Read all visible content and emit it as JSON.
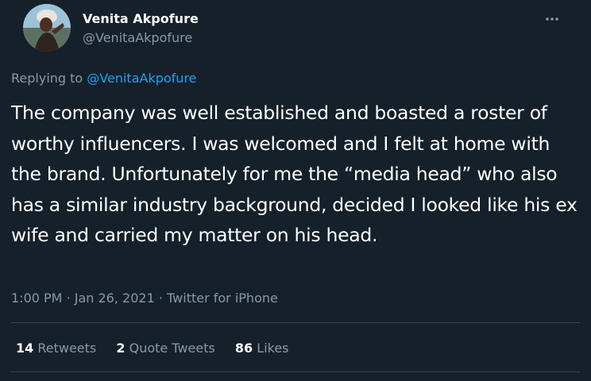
{
  "author": {
    "name": "Venita Akpofure",
    "handle": "@VenitaAkpofure"
  },
  "menu_icon": "more-horizontal-icon",
  "reply": {
    "prefix": "Replying to",
    "mention": "@VenitaAkpofure"
  },
  "body": "The company was well established and boasted a roster of worthy influencers. I was welcomed and I felt at home with the brand. Unfortunately for me the “media head” who also has a similar industry background, decided I looked like his ex wife and carried my matter on his head.",
  "meta": {
    "time": "1:00 PM",
    "sep1": "·",
    "date": "Jan 26, 2021",
    "sep2": "·",
    "source": "Twitter for iPhone"
  },
  "stats": {
    "retweets_count": "14",
    "retweets_label": "Retweets",
    "quotes_count": "2",
    "quotes_label": "Quote Tweets",
    "likes_count": "86",
    "likes_label": "Likes"
  },
  "colors": {
    "background": "#15202b",
    "text": "#ffffff",
    "secondary": "#8899a6",
    "accent": "#1da1f2",
    "border": "#38444d"
  }
}
